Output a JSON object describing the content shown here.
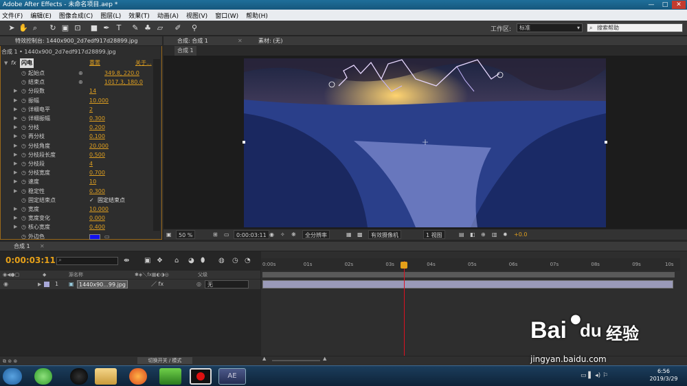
{
  "window": {
    "title": "Adobe After Effects - 未命名项目.aep *",
    "min": "—",
    "max": "□",
    "close": "✕"
  },
  "menu": [
    "文件(F)",
    "编辑(E)",
    "图像合成(C)",
    "图层(L)",
    "效果(T)",
    "动画(A)",
    "视图(V)",
    "窗口(W)",
    "帮助(H)"
  ],
  "toolbar": {
    "workspace_label": "工作区:",
    "workspace_value": "标准",
    "help_placeholder": "搜索帮助"
  },
  "effects_panel": {
    "tab": "特效控制台: 1440x900_2d7edf917d28899.jpg",
    "breadcrumb": "合成 1 • 1440x900_2d7edf917d28899.jpg",
    "effect_name": "闪电",
    "reset": "重置",
    "about": "关于...",
    "properties": [
      {
        "name": "起始点",
        "value": "349.8, 220.0",
        "expand": false,
        "point": true
      },
      {
        "name": "结束点",
        "value": "1017.3, 180.0",
        "expand": false,
        "point": true
      },
      {
        "name": "分段数",
        "value": "14",
        "expand": true
      },
      {
        "name": "振幅",
        "value": "10.000",
        "expand": true
      },
      {
        "name": "详细电平",
        "value": "2",
        "expand": true
      },
      {
        "name": "详细振幅",
        "value": "0.300",
        "expand": true
      },
      {
        "name": "分枝",
        "value": "0.200",
        "expand": true
      },
      {
        "name": "再分枝",
        "value": "0.100",
        "expand": true
      },
      {
        "name": "分枝角度",
        "value": "20.000",
        "expand": true
      },
      {
        "name": "分枝段长度",
        "value": "0.500",
        "expand": true
      },
      {
        "name": "分枝段",
        "value": "4",
        "expand": true
      },
      {
        "name": "分枝宽度",
        "value": "0.700",
        "expand": true
      },
      {
        "name": "速度",
        "value": "10",
        "expand": true
      },
      {
        "name": "稳定性",
        "value": "0.300",
        "expand": true
      },
      {
        "name": "固定结束点",
        "value": "固定结束点",
        "expand": false,
        "checkbox": true
      },
      {
        "name": "宽度",
        "value": "10.000",
        "expand": true
      },
      {
        "name": "宽度变化",
        "value": "0.000",
        "expand": true
      },
      {
        "name": "核心宽度",
        "value": "0.400",
        "expand": true
      },
      {
        "name": "外边色",
        "value": "",
        "expand": false,
        "color": "#1212ee"
      }
    ]
  },
  "viewer": {
    "tab": "合成: 合成 1",
    "footage": "素材: (无)",
    "comp_label": "合成 1",
    "zoom": "50 %",
    "timecode": "0:00:03:11",
    "resolution": "全分辨率",
    "camera": "有效摄像机",
    "views": "1 视图",
    "offset": "+0.0"
  },
  "timeline": {
    "tab": "合成 1",
    "timecode": "0:00:03:11",
    "col_source": "源名称",
    "col_parent": "父级",
    "layer": {
      "num": "1",
      "name": "1440x90...99.jpg",
      "parent": "无"
    },
    "ticks": [
      "0:00s",
      "01s",
      "02s",
      "03s",
      "04s",
      "05s",
      "06s",
      "07s",
      "08s",
      "09s",
      "10s"
    ],
    "playhead_sec": 3.44,
    "toggle_label": "切换开关 / 模式"
  },
  "clock": {
    "time": "6:56",
    "date": "2019/3/29"
  },
  "watermark": {
    "brand": "Bai",
    "paw": "du",
    "cn": "经验",
    "url": "jingyan.baidu.com"
  }
}
